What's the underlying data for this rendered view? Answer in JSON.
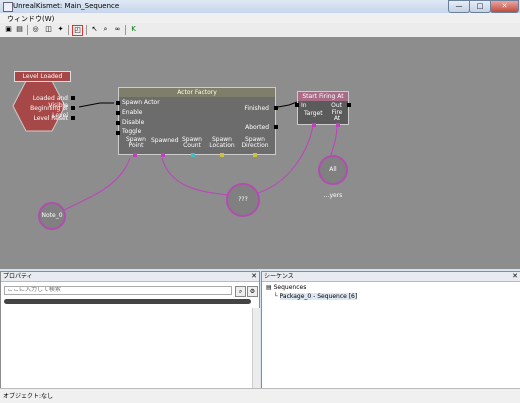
{
  "window": {
    "title": "UnrealKismet: Main_Sequence",
    "minimize": "—",
    "maximize": "□",
    "close": "✕"
  },
  "menu": {
    "window_label": "ウィンドウ(W)"
  },
  "toolbar": {
    "icons": [
      "save-icon",
      "open-icon",
      "search-icon",
      "parent-icon",
      "hide-icon",
      "fit-icon",
      "pointer-icon",
      "zoom-icon",
      "link-icon",
      "kismet-icon"
    ]
  },
  "canvas": {
    "event": {
      "label": "Level Loaded",
      "outputs": [
        "Loaded and Visible",
        "Beginning of Level",
        "Level Reset"
      ]
    },
    "actor_factory": {
      "title": "Actor Factory",
      "inputs": [
        "Spawn Actor",
        "Enable",
        "Disable",
        "Toggle"
      ],
      "outputs": [
        "Finished",
        "Aborted"
      ],
      "vars": [
        "Spawn\nPoint",
        "Spawned",
        "Spawn\nCount",
        "Spawn\nLocation",
        "Spawn\nDirection"
      ]
    },
    "start_firing": {
      "title": "Start Firing At",
      "input": "In",
      "output": "Out",
      "vars": [
        "Target",
        "Fire\nAt"
      ]
    },
    "var_note": "Note_0",
    "var_unknown": "???",
    "var_players": "All ...yers"
  },
  "properties": {
    "title": "プロパティ",
    "search_placeholder": "ここに入力して検索",
    "close": "✕"
  },
  "sequences": {
    "title": "シーケンス",
    "root": "Sequences",
    "child": "Package_0 - Sequence [6]",
    "close": "✕"
  },
  "status": {
    "text": "オブジェクト:なし"
  },
  "colors": {
    "canvas": "#8d8d8d",
    "event": "#a64848",
    "wire": "#c040c0"
  }
}
